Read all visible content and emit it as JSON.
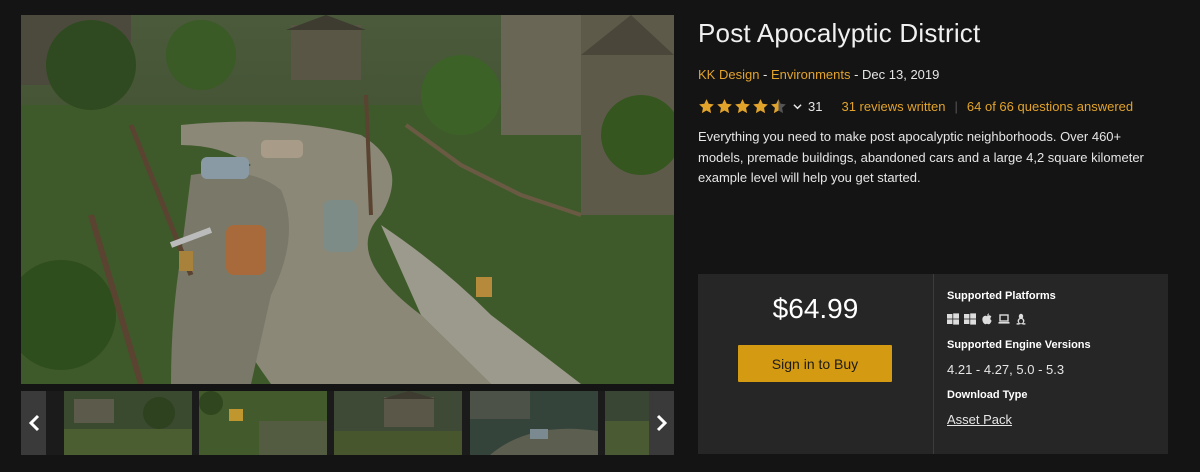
{
  "product": {
    "title": "Post Apocalyptic District",
    "author": "KK Design",
    "separator_1": " - ",
    "category": "Environments",
    "separator_2": " - ",
    "date": "Dec 13, 2019",
    "rating_value": 4.5,
    "rating_count": "31",
    "reviews_link": "31 reviews written",
    "rating_divider": "|",
    "questions_link": "64 of 66 questions answered",
    "description": "Everything you need to make post apocalyptic neighborhoods. Over 460+ models, premade buildings, abandoned cars and a large 4,2 square kilometer example level will help you get started."
  },
  "purchase": {
    "price": "$64.99",
    "buy_label": "Sign in to Buy",
    "platforms_heading": "Supported Platforms",
    "platform_icons": [
      "windows-icon",
      "windows-icon",
      "apple-icon",
      "laptop-icon",
      "linux-icon"
    ],
    "engine_heading": "Supported Engine Versions",
    "engine_versions": "4.21 - 4.27, 5.0 - 5.3",
    "download_heading": "Download Type",
    "download_type": "Asset Pack"
  },
  "gallery": {
    "prev_icon": "chevron-left-icon",
    "next_icon": "chevron-right-icon",
    "thumbnail_count": 5
  },
  "colors": {
    "accent": "#e2a32b",
    "button": "#d39a12",
    "panel": "#262626",
    "background": "#141414"
  }
}
